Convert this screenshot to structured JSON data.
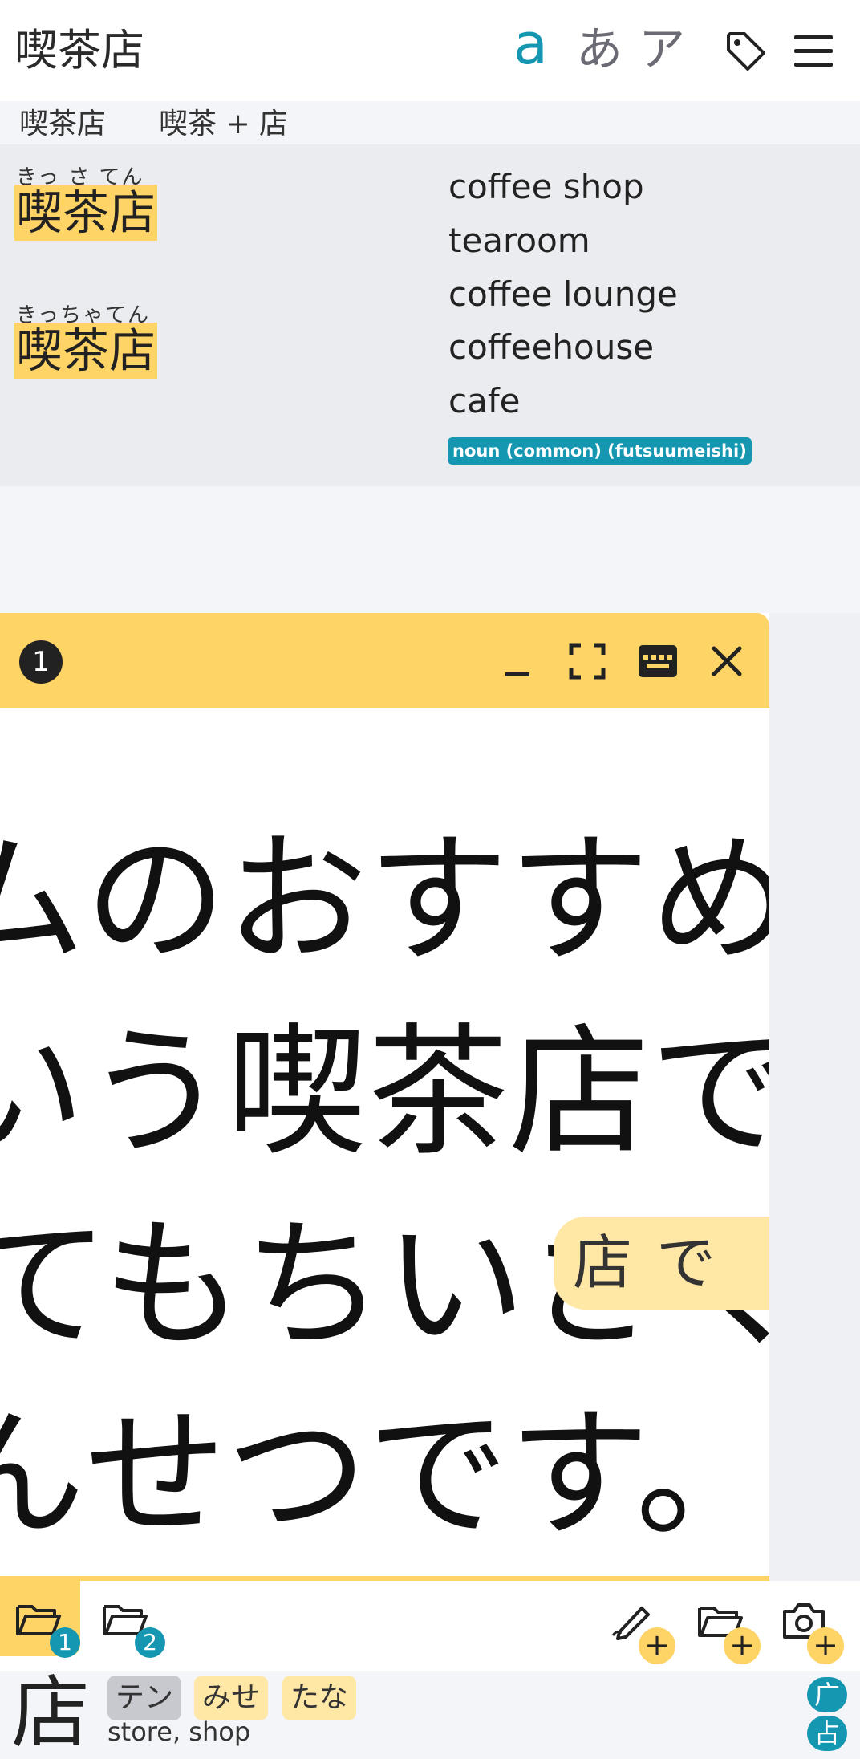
{
  "header": {
    "title": "喫茶店",
    "modes": [
      "a",
      "あ",
      "ア"
    ],
    "accent_color": "#1597b1"
  },
  "segmentation": {
    "segments": [
      "喫茶店",
      "喫茶 + 店"
    ]
  },
  "entry": {
    "readings": [
      {
        "ruby": "きっ さ てん",
        "kanji": "喫茶店"
      },
      {
        "ruby": "きっちゃてん",
        "kanji": "喫茶店"
      }
    ],
    "glosses": [
      "coffee shop",
      "tearoom",
      "coffee lounge",
      "coffeehouse",
      "cafe"
    ],
    "pos": "noun (common) (futsuumeishi)",
    "highlight_color": "#ffd466"
  },
  "panel": {
    "number": "1",
    "lines": [
      "ムのおすすめ",
      "いう喫茶店でで",
      "てもちいさくて",
      "んせつです。"
    ],
    "bubble_text": "店で"
  },
  "toolbar": {
    "folder_1_badge": "1",
    "folder_2_badge": "2",
    "plus_label": "+"
  },
  "kanji_info": {
    "kanji": "店",
    "readings": [
      "テン",
      "みせ",
      "たな"
    ],
    "meaning": "store, shop",
    "radicals": [
      "广",
      "占"
    ]
  }
}
